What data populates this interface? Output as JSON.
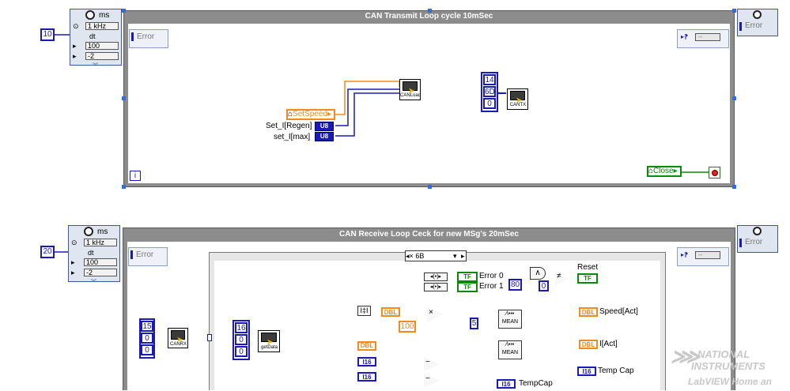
{
  "loop1": {
    "title": "CAN Transmit Loop cycle 10mSec",
    "iteration_label": "i",
    "timing": {
      "units": "ms",
      "source": "1 kHz",
      "dt": "dt",
      "priority": "100",
      "processor": "-2",
      "wired_const": "10"
    },
    "left_error": "Error",
    "right_error": "Error",
    "right_shift_value": "--",
    "setspeed_label": "SetSpeed",
    "set_i_regen": "Set_I[Regen]",
    "set_i_max": "set_I[max]",
    "u8_a": "U8",
    "u8_b": "U8",
    "canload_label": "CANLoad",
    "canconst": [
      "14",
      "6D",
      "0"
    ],
    "cantx_label": "CANTX",
    "close_label": "Close"
  },
  "loop2": {
    "title": "CAN Receive Loop Ceck for new MSg's 20mSec",
    "timing": {
      "units": "ms",
      "source": "1 kHz",
      "dt": "dt",
      "priority": "100",
      "processor": "-2",
      "wired_const": "20"
    },
    "left_error": "Error",
    "right_error": "Error",
    "right_shift_value": "--",
    "rx_const": [
      "15",
      "0",
      "0"
    ],
    "canrx_label": "CANRX",
    "case_selector": "6B",
    "getdata_const": [
      "16",
      "0",
      "0"
    ],
    "getdata_label": "getData",
    "error0": "Error 0",
    "error1": "Error 1",
    "tf_a": "TF",
    "tf_b": "TF",
    "reset_label": "Reset",
    "reset_tf": "TF",
    "const80": "80",
    "const0": "0",
    "const100": "100",
    "const5": "5",
    "dbl_a": "DBL",
    "dbl_b": "DBL",
    "mean_a": "MEAN",
    "mean_b": "MEAN",
    "speed_act_ind": "DBL",
    "speed_act_label": "Speed[Act]",
    "i_act_ind": "DBL",
    "i_act_label": "I[Act]",
    "i16_a": "I16",
    "i16_b": "I16",
    "temp_cap_ind": "I16",
    "temp_cap_label": "Temp Cap",
    "tempcap_ind": "I16",
    "tempcap_label": "TempCap"
  },
  "watermark": {
    "line1": "NATIONAL",
    "line2": "INSTRUMENTS",
    "line3": "LabVIEW Home an"
  },
  "colors": {
    "wire_orange": "#f08b1f",
    "wire_blue": "#1a1ab8",
    "wire_green": "#0a8a0a",
    "loop_gray": "#8c8c8c",
    "selection_blue": "#2f6fd6"
  }
}
